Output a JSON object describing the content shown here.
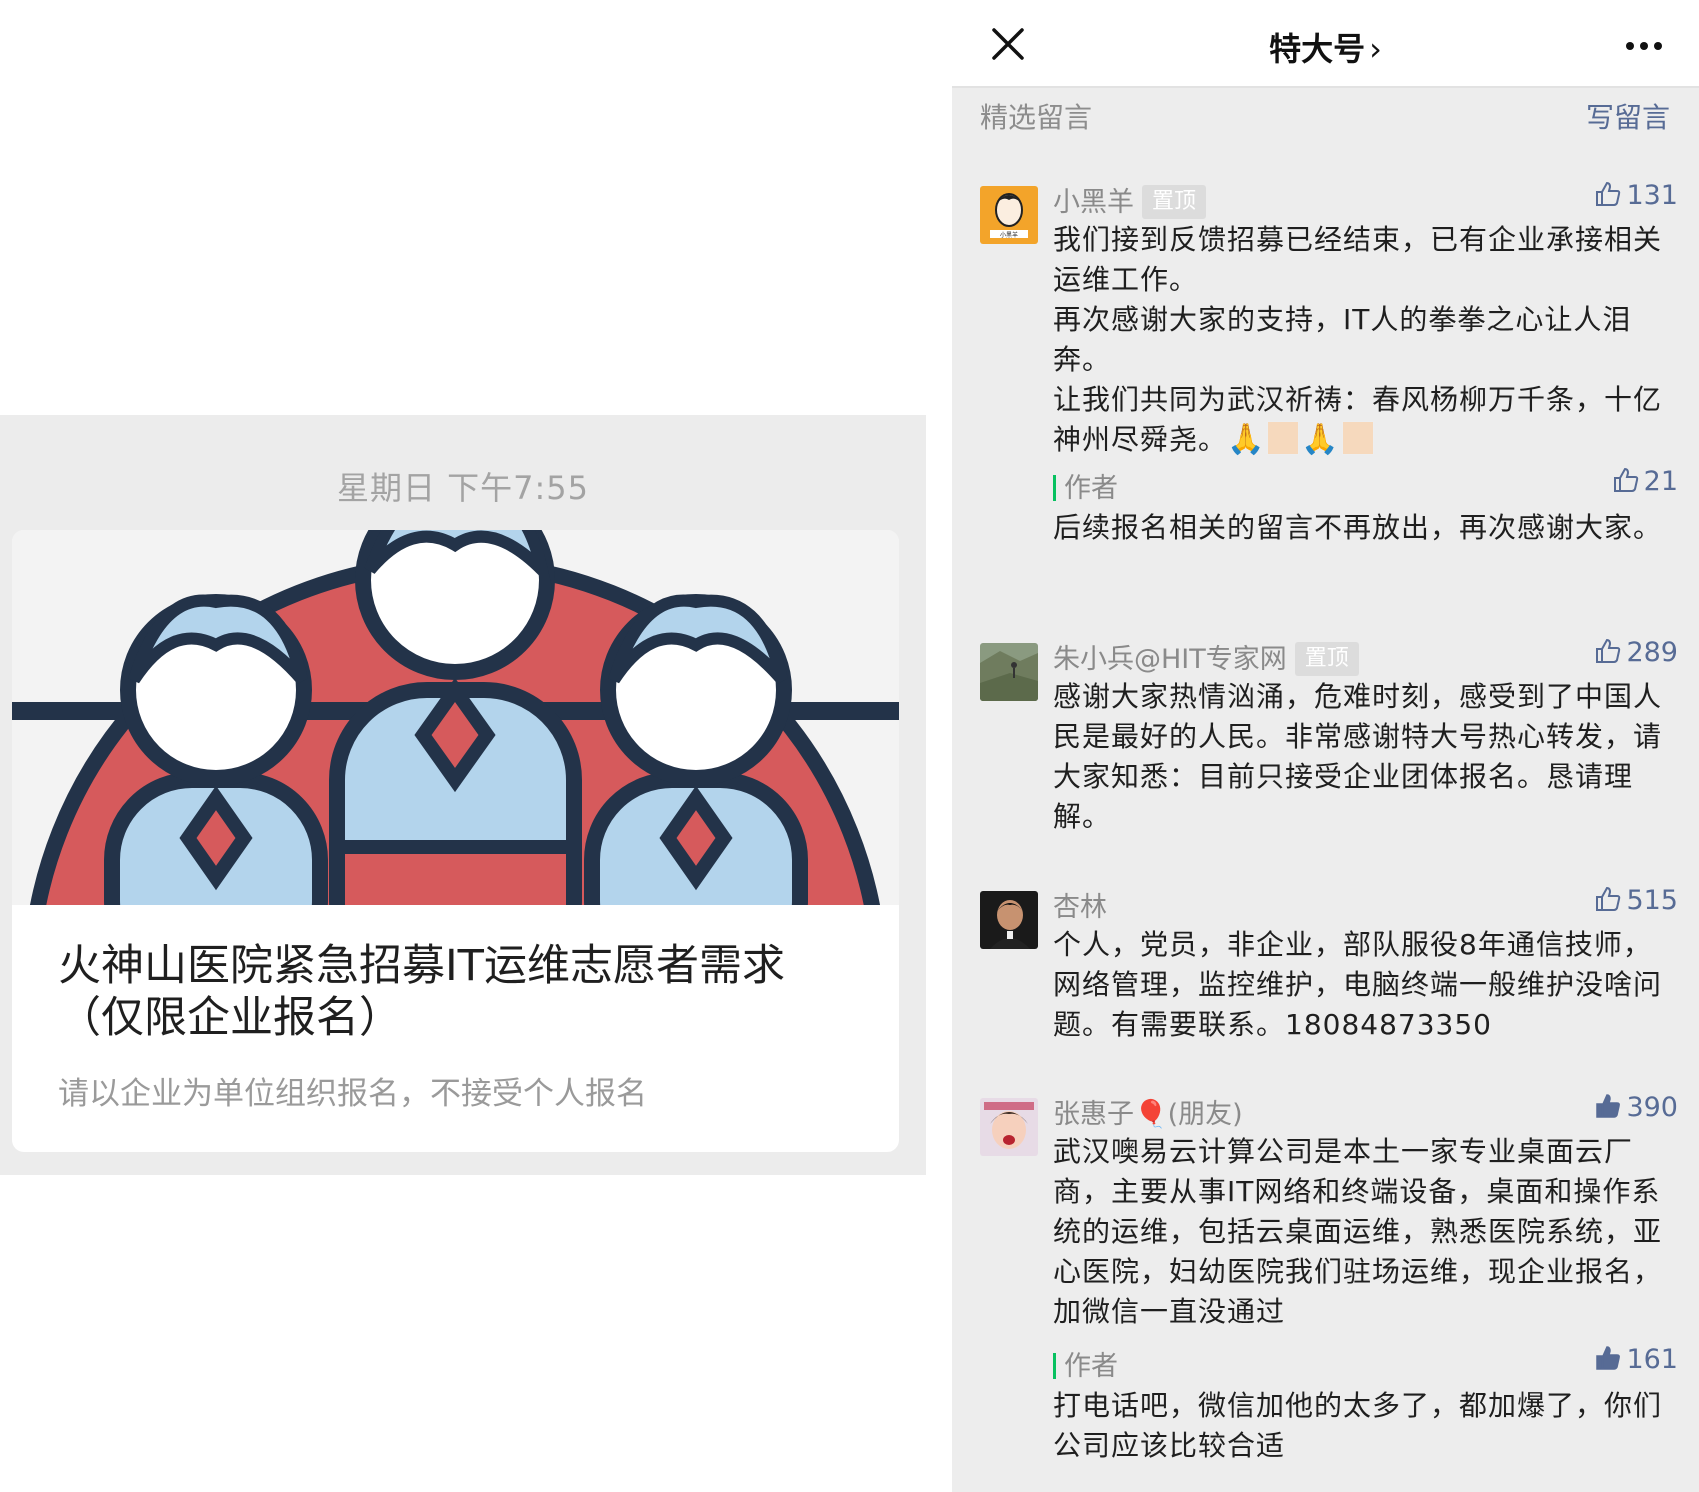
{
  "left": {
    "timestamp": "星期日 下午7:55",
    "article": {
      "title": "火神山医院紧急招募IT运维志愿者需求（仅限企业报名）",
      "description": "请以企业为单位组织报名，不接受个人报名"
    }
  },
  "right": {
    "topbar": {
      "title": "特大号",
      "chevron": "›",
      "close_icon": "close-icon",
      "more_icon": "more-icon"
    },
    "section_title": "精选留言",
    "write_comment": "写留言",
    "colors": {
      "link_blue": "#576b95",
      "author_green": "#07c160",
      "pin_badge_bg": "#dcdcdc"
    },
    "comments": [
      {
        "nickname": "小黑羊",
        "pinned": "置顶",
        "likes": "131",
        "liked_filled": false,
        "lines": [
          "我们接到反馈招募已经结束，已有企业承接相关运维工作。",
          "再次感谢大家的支持，IT人的拳拳之心让人泪奔。",
          "让我们共同为武汉祈祷：春风杨柳万千条，十亿神州尽舜尧。"
        ],
        "emoji": "🙏",
        "reply": {
          "label": "作者",
          "likes": "21",
          "text": "后续报名相关的留言不再放出，再次感谢大家。"
        }
      },
      {
        "nickname": "朱小兵@HIT专家网",
        "pinned": "置顶",
        "likes": "289",
        "liked_filled": false,
        "text": "感谢大家热情汹涌，危难时刻，感受到了中国人民是最好的人民。非常感谢特大号热心转发，请大家知悉：目前只接受企业团体报名。恳请理解。"
      },
      {
        "nickname": "杏林",
        "likes": "515",
        "liked_filled": false,
        "text": "个人，党员，非企业，部队服役8年通信技师，网络管理，监控维护，电脑终端一般维护没啥问题。有需要联系。18084873350"
      },
      {
        "nickname": "张惠子",
        "nickname_emoji": "🎈",
        "friend_tag": "(朋友)",
        "likes": "390",
        "liked_filled": true,
        "text": "武汉噢易云计算公司是本土一家专业桌面云厂商，主要从事IT网络和终端设备，桌面和操作系统的运维，包括云桌面运维，熟悉医院系统，亚心医院，妇幼医院我们驻场运维，现企业报名，加微信一直没通过",
        "reply": {
          "label": "作者",
          "likes": "161",
          "liked_filled": true,
          "text": "打电话吧，微信加他的太多了，都加爆了，你们公司应该比较合适"
        }
      }
    ]
  }
}
